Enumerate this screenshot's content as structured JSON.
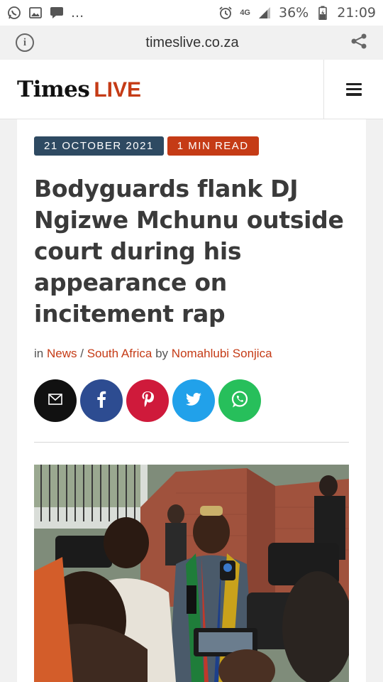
{
  "status_bar": {
    "battery": "36%",
    "time": "21:09",
    "network": "4G",
    "more": "..."
  },
  "browser": {
    "url": "timeslive.co.za"
  },
  "site": {
    "logo_primary": "Times",
    "logo_secondary": "LIVE"
  },
  "article": {
    "date": "21 OCTOBER 2021",
    "read_time": "1 MIN READ",
    "headline": "Bodyguards flank DJ Ngizwe Mchunu outside court during his appearance on incitement rap",
    "byline": {
      "in": "in",
      "category": "News",
      "separator": "/",
      "subcategory": "South Africa",
      "by": "by",
      "author": "Nomahlubi Sonjica"
    },
    "share_icons": [
      "mail-icon",
      "facebook-icon",
      "pinterest-icon",
      "twitter-icon",
      "whatsapp-icon"
    ]
  },
  "colors": {
    "accent": "#c53b16",
    "date_badge": "#2e4a62",
    "facebook": "#2d4c91",
    "pinterest": "#cf1a3b",
    "twitter": "#21a1ea",
    "whatsapp": "#27bf5b"
  }
}
